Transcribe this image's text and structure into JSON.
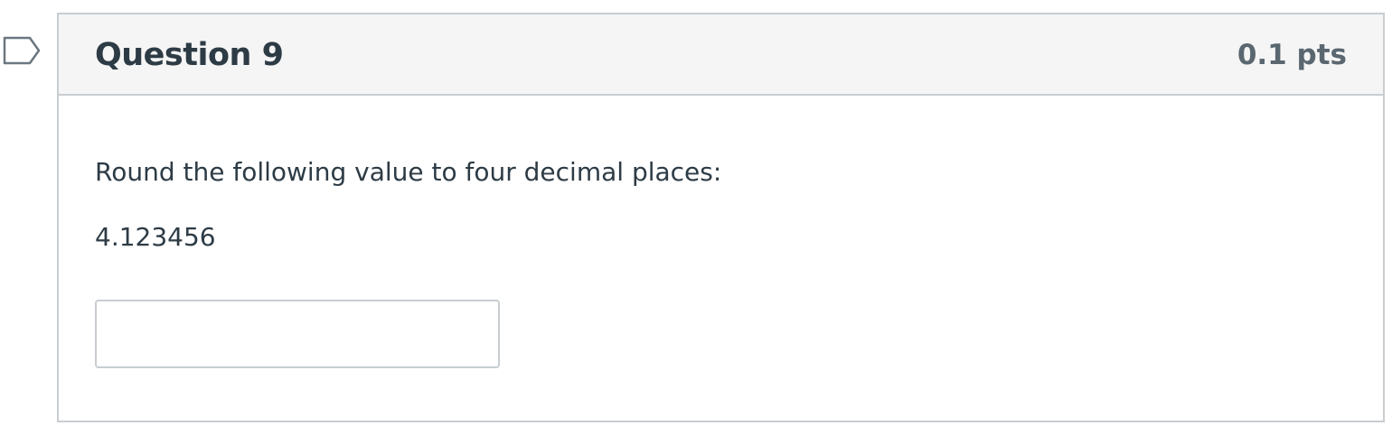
{
  "flag": {
    "icon": "flag-icon"
  },
  "question": {
    "title": "Question 9",
    "points": "0.1 pts",
    "prompt": "Round the following value to four decimal places:",
    "value": "4.123456",
    "answer_value": ""
  },
  "colors": {
    "border": "#c7cdd1",
    "header_bg": "#f5f5f5",
    "text": "#2d3b45",
    "points_text": "#5b6770",
    "flag": "#6b7780"
  }
}
